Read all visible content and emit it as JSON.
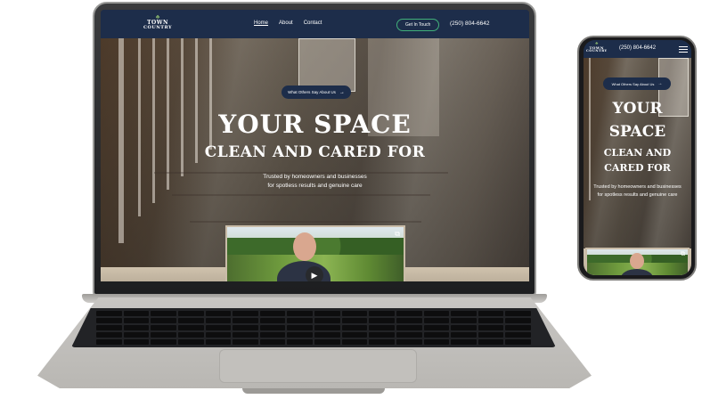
{
  "site": {
    "logo": {
      "line1": "TOWN",
      "line2": "COUNTRY"
    },
    "nav": {
      "links": [
        {
          "label": "Home",
          "active": true
        },
        {
          "label": "About",
          "active": false
        },
        {
          "label": "Contact",
          "active": false
        }
      ],
      "cta_label": "Get In Touch",
      "phone": "(250) 804-6642"
    },
    "hero": {
      "pill_label": "What Others Say About Us",
      "pill_arrow": "→",
      "headline_line1": "YOUR SPACE",
      "headline_line2": "CLEAN AND CARED FOR",
      "mobile_headline_line1": "YOUR",
      "mobile_headline_line2": "SPACE",
      "mobile_headline_line3": "CLEAN AND",
      "mobile_headline_line4": "CARED FOR",
      "sub_line1": "Trusted by homeowners and businesses",
      "sub_line2": "for spotless results and genuine care"
    },
    "video": {
      "play_glyph": "▶",
      "external_glyph": "⧉"
    }
  },
  "colors": {
    "nav_bg": "#1d2d4a",
    "cta_border": "#41b07a",
    "device_frame": "#1d1e20",
    "laptop_body": "#c8c6c3"
  },
  "icons": {
    "menu": "hamburger-icon",
    "play": "play-icon",
    "external": "external-link-icon",
    "arrow": "arrow-right-icon"
  }
}
